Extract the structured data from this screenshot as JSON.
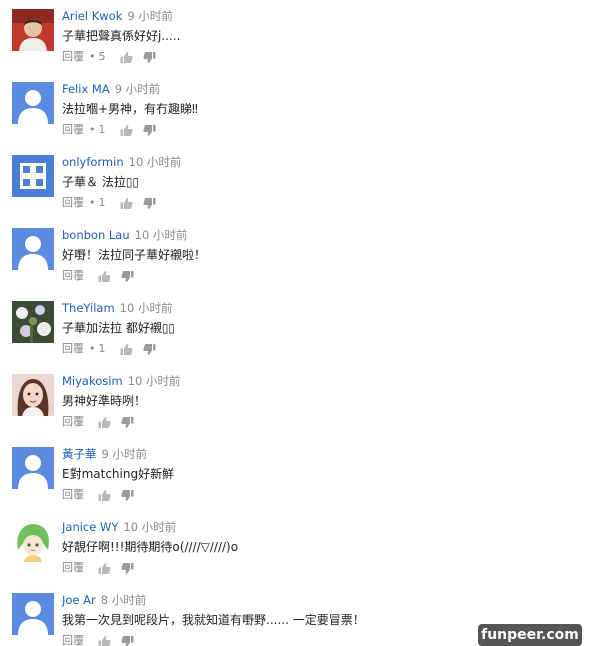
{
  "comments": [
    {
      "author": "Ariel Kwok",
      "time": "9 小时前",
      "text": "子華把聲真係好好j.....",
      "reply": "回覆",
      "likes": "5",
      "avatar": "photo-avatar-red"
    },
    {
      "author": "Felix MA",
      "time": "9 小时前",
      "text": "法拉嗰+男神，有冇趣睇‼",
      "reply": "回覆",
      "likes": "1",
      "avatar": "default-user-avatar"
    },
    {
      "author": "onlyformin",
      "time": "10 小时前",
      "text": "子華＆ 法拉▯▯",
      "reply": "回覆",
      "likes": "1",
      "avatar": "pattern-avatar-blue"
    },
    {
      "author": "bonbon Lau",
      "time": "10 小时前",
      "text": "好嘢！法拉同子華好襯啦！",
      "reply": "回覆",
      "likes": "",
      "avatar": "default-user-avatar"
    },
    {
      "author": "TheYilam",
      "time": "10 小时前",
      "text": "子華加法拉 都好襯▯▯",
      "reply": "回覆",
      "likes": "1",
      "avatar": "photo-avatar-flowers"
    },
    {
      "author": "Miyakosim",
      "time": "10 小时前",
      "text": "男神好準時咧！",
      "reply": "回覆",
      "likes": "",
      "avatar": "photo-avatar-girl"
    },
    {
      "author": "黃子華",
      "time": "9 小时前",
      "text": "E對matching好新鮮",
      "reply": "回覆",
      "likes": "",
      "avatar": "default-user-avatar"
    },
    {
      "author": "Janice WY",
      "time": "10 小时前",
      "text": "好靚仔啊!!!期待期待o(////▽////)o",
      "reply": "回覆",
      "likes": "",
      "avatar": "anime-avatar-green"
    },
    {
      "author": "Joe Ar",
      "time": "8 小时前",
      "text": "我第一次見到呢段片，我就知道有嘢野...... 一定要冒票！",
      "reply": "回覆",
      "likes": "",
      "avatar": "default-user-avatar"
    }
  ],
  "watermark": "funpeer.com",
  "colors": {
    "author": "#1e5fb8",
    "avatar_blue": "#5b8be0",
    "meta": "#8a8a8a"
  }
}
